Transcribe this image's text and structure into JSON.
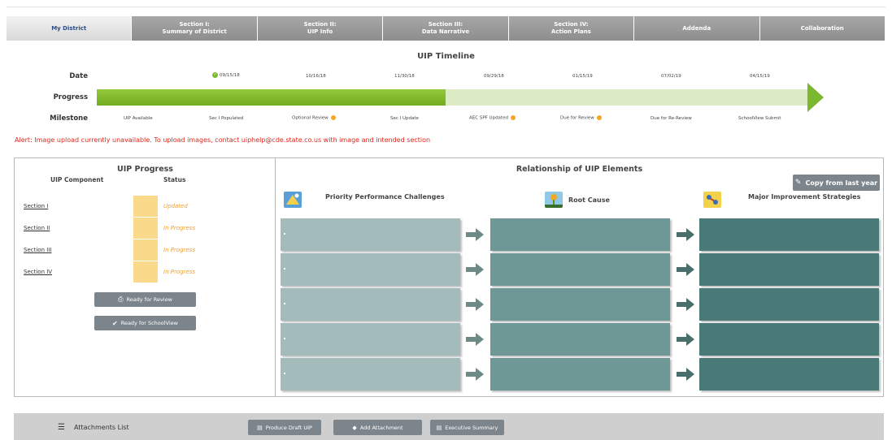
{
  "tabs": [
    {
      "line1": "My District",
      "line2": ""
    },
    {
      "line1": "Section I:",
      "line2": "Summary of District"
    },
    {
      "line1": "Section II:",
      "line2": "UIP Info"
    },
    {
      "line1": "Section III:",
      "line2": "Data Narrative"
    },
    {
      "line1": "Section IV:",
      "line2": "Action Plans"
    },
    {
      "line1": "Addenda",
      "line2": ""
    },
    {
      "line1": "Collaboration",
      "line2": ""
    }
  ],
  "timeline": {
    "title": "UIP Timeline",
    "date_label": "Date",
    "progress_label": "Progress",
    "milestone_label": "Milestone",
    "progress_fraction": 0.49,
    "dates": [
      "09/15/18",
      "10/16/18",
      "11/30/18",
      "09/29/18",
      "01/15/19",
      "07/02/19",
      "04/15/19"
    ],
    "milestones": [
      "UIP Available",
      "Sec I Populated",
      "Optional Review",
      "Sec I Update",
      "AEC SPF Updated",
      "Due for Review",
      "Due for Re-Review",
      "SchoolView Submit"
    ]
  },
  "alert": "Alert: Image upload currently unavailable. To upload images, contact uiphelp@cde.state.co.us with image and intended section",
  "progress": {
    "title": "UIP Progress",
    "col_component": "UIP Component",
    "col_status": "Status",
    "rows": [
      {
        "section": "Section I",
        "status": "Updated"
      },
      {
        "section": "Section II",
        "status": "In Progress"
      },
      {
        "section": "Section III",
        "status": "In Progress"
      },
      {
        "section": "Section IV",
        "status": "In Progress"
      }
    ],
    "ready_review": "Ready for Review",
    "ready_schoolview": "Ready for SchoolView"
  },
  "relationship": {
    "title": "Relationship of UIP Elements",
    "copy_button": "Copy from last year",
    "col1": "Priority Performance Challenges",
    "col2": "Root Cause",
    "col3": "Major Improvement Strategies"
  },
  "footer": {
    "attachments": "Attachments List",
    "produce_draft": "Produce Draft UIP",
    "add_attachment": "Add Attachment",
    "exec_summary": "Executive Summary"
  },
  "colors": {
    "progress_green": "#7cb82f",
    "alert_red": "#e0271c",
    "status_yellow": "#fbd98a",
    "teal_light": "#a3bcbb",
    "teal_mid": "#6e9896",
    "teal_dark": "#4a7a77"
  }
}
